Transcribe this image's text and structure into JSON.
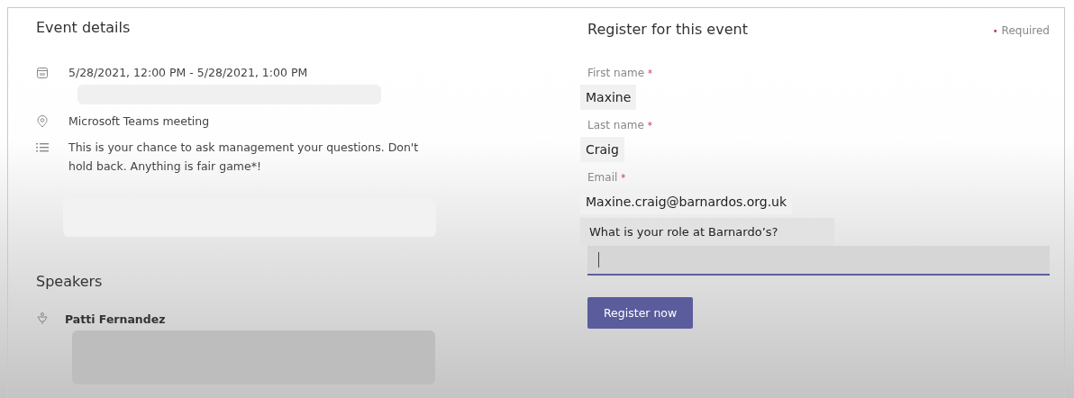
{
  "event_details": {
    "title": "Event details",
    "items": [
      {
        "kind": "date",
        "text": "5/28/2021, 12:00 PM - 5/28/2021, 1:00 PM"
      },
      {
        "kind": "location",
        "text": "Microsoft Teams meeting"
      },
      {
        "kind": "description",
        "text": "This is your chance to ask management your questions. Don't hold back. Anything is fair game*!"
      }
    ]
  },
  "speakers": {
    "title": "Speakers",
    "items": [
      {
        "name": "Patti Fernandez"
      }
    ]
  },
  "registration": {
    "title": "Register for this event",
    "required_note": "Required",
    "required_bullet": "•",
    "required_mark": "*",
    "fields": [
      {
        "label": "First name",
        "required": true,
        "value": "Maxine"
      },
      {
        "label": "Last name",
        "required": true,
        "value": "Craig"
      },
      {
        "label": "Email",
        "required": true,
        "value": "Maxine.craig@barnardos.org.uk"
      },
      {
        "label": "What is your role at Barnardo’s?",
        "required": false,
        "focused": true
      }
    ],
    "button": "Register now"
  }
}
